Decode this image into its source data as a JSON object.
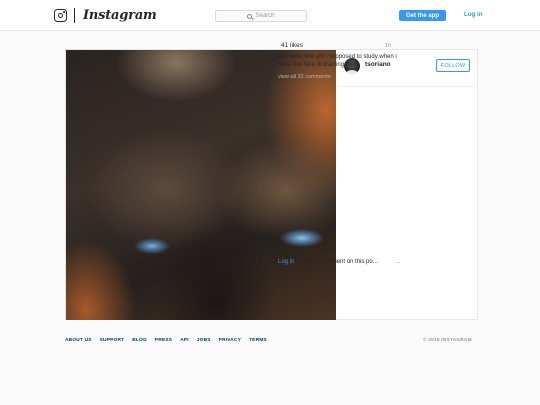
{
  "topbar": {
    "wordmark": "Instagram",
    "search_placeholder": "Search",
    "get_app_label": "Get the app",
    "login_label": "Log in"
  },
  "post": {
    "username": "tsoriano",
    "follow_label": "FOLLOW",
    "likes": "41 likes",
    "time_ago": "1h",
    "caption_user": "tsoriano",
    "caption_text": "how am i supposed to study when i have this face distracting me?",
    "view_comments": "view all 32 comments",
    "login_link": "Log in",
    "comment_prompt": "to like or comment on this po...",
    "more_options": "…"
  },
  "footer": {
    "links": [
      "ABOUT US",
      "SUPPORT",
      "BLOG",
      "PRESS",
      "API",
      "JOBS",
      "PRIVACY",
      "TERMS"
    ],
    "copyright": "© 2019 INSTAGRAM"
  },
  "colors": {
    "accent": "#3897f0",
    "footer_link": "#003569",
    "muted": "#999999"
  },
  "icons": {
    "logo": "instagram-camera-icon",
    "search": "search-icon",
    "more": "more-options-icon"
  }
}
